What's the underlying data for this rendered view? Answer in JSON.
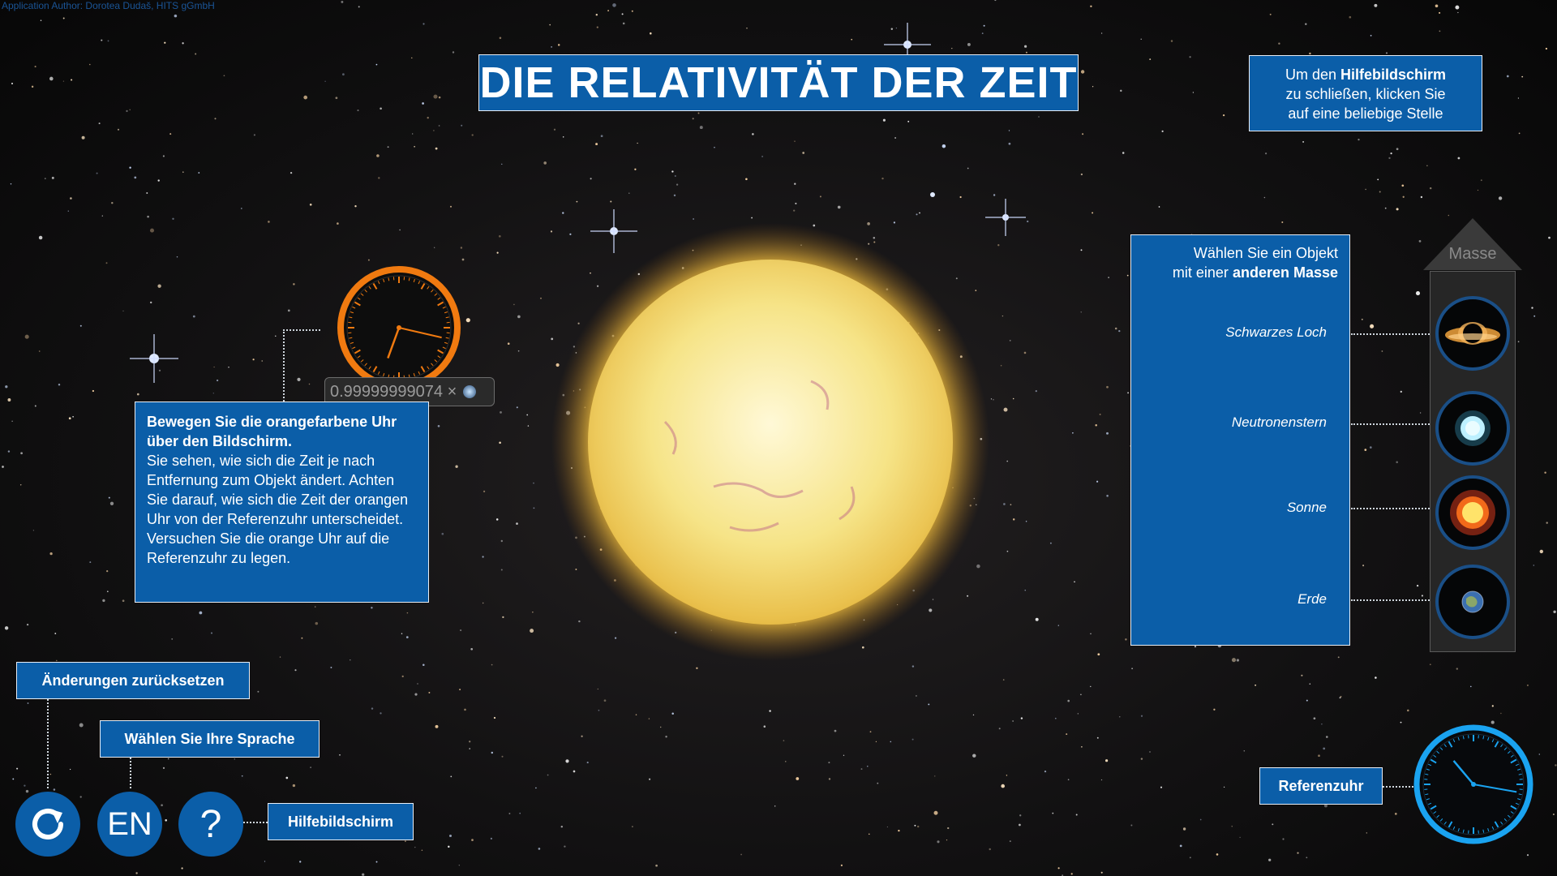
{
  "credit": "Application Author: Dorotea Dudaš, HITS gGmbH",
  "title": "DIE RELATIVITÄT DER ZEIT",
  "help_close": {
    "line1_prefix": "Um den ",
    "line1_bold": "Hilfebildschirm",
    "line2": "zu schließen, klicken Sie",
    "line3": "auf eine beliebige Stelle"
  },
  "instructions": {
    "bold": "Bewegen Sie die orangefarbene Uhr über den Bildschirm.",
    "text": "Sie sehen, wie sich die Zeit je nach Entfernung zum Objekt ändert. Achten Sie darauf, wie sich die Zeit der orangen Uhr von der Referenzuhr unterscheidet. Versuchen Sie die orange Uhr auf die Referenzuhr zu legen."
  },
  "orange_clock": {
    "factor_text": "0.99999999074 ×",
    "hour_hand_deg": 200,
    "minute_hand_deg": 103
  },
  "object_select": {
    "head_line1": "Wählen Sie ein Objekt",
    "head_line2_prefix": "mit einer ",
    "head_line2_bold": "anderen Masse",
    "mass_label": "Masse",
    "objects": [
      {
        "name": "Schwarzes Loch",
        "icon": "black-hole-icon"
      },
      {
        "name": "Neutronenstern",
        "icon": "neutron-star-icon"
      },
      {
        "name": "Sonne",
        "icon": "sun-icon"
      },
      {
        "name": "Erde",
        "icon": "earth-icon"
      }
    ]
  },
  "buttons": {
    "reset_label": "Änderungen zurücksetzen",
    "language_label": "Wählen Sie Ihre Sprache",
    "language_code": "EN",
    "help_label": "Hilfebildschirm",
    "help_symbol": "?"
  },
  "reference_clock": {
    "label": "Referenzuhr",
    "hour_hand_deg": 320,
    "minute_hand_deg": 100
  },
  "colors": {
    "panel_blue": "#0b5ea8",
    "orange_clock": "#f07a10",
    "reference_clock": "#1aa3f0"
  }
}
